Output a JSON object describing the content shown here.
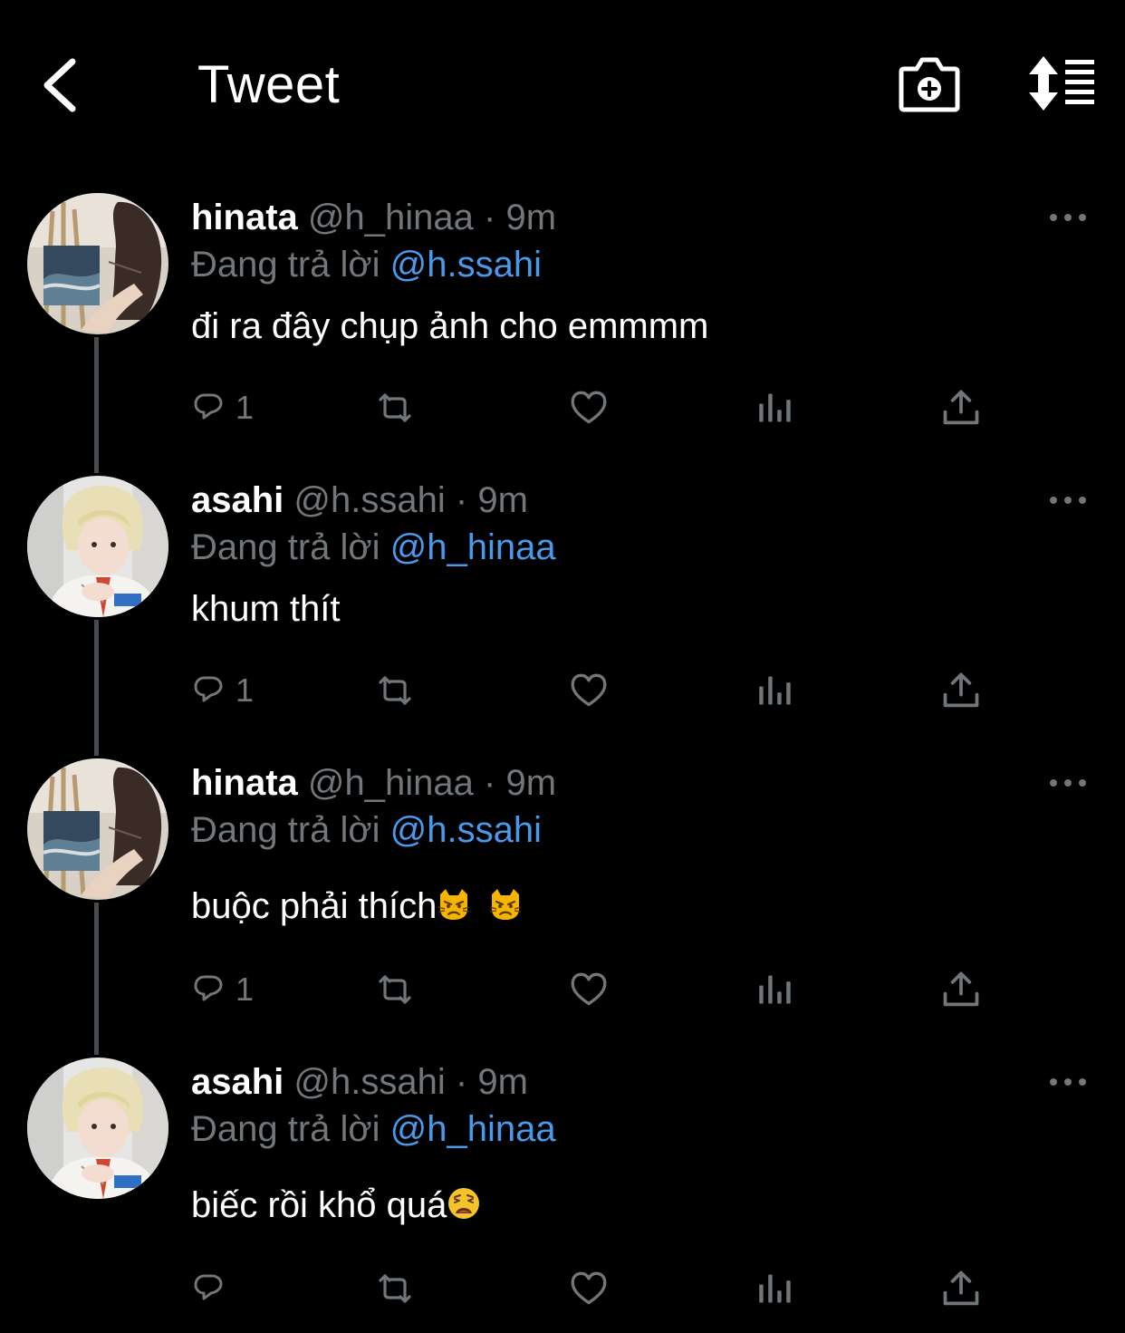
{
  "header": {
    "back_icon": "chevron-left-icon",
    "title": "Tweet",
    "camera_icon": "camera-add-icon",
    "sort_icon": "sort-list-icon"
  },
  "colors": {
    "background": "#000000",
    "text_primary": "#ffffff",
    "text_secondary": "#71767b",
    "mention": "#4a99e9",
    "thread_line": "#444b52"
  },
  "tweets": [
    {
      "name": "hinata",
      "handle": "@h_hinaa",
      "dot": "·",
      "time": "9m",
      "reply_prefix": "Đang trả lời",
      "reply_to": "@h.ssahi",
      "text": "đi ra đây chụp ảnh cho emmmm",
      "reply_count": "1",
      "avatar": "painting-girl-avatar"
    },
    {
      "name": "asahi",
      "handle": "@h.ssahi",
      "dot": "·",
      "time": "9m",
      "reply_prefix": "Đang trả lời",
      "reply_to": "@h_hinaa",
      "text": "khum thít",
      "reply_count": "1",
      "avatar": "blond-boy-avatar"
    },
    {
      "name": "hinata",
      "handle": "@h_hinaa",
      "dot": "·",
      "time": "9m",
      "reply_prefix": "Đang trả lời",
      "reply_to": "@h.ssahi",
      "text": "buộc phải thích",
      "emojis": [
        "pouting-cat-emoji",
        "pouting-cat-emoji"
      ],
      "reply_count": "1",
      "avatar": "painting-girl-avatar"
    },
    {
      "name": "asahi",
      "handle": "@h.ssahi",
      "dot": "·",
      "time": "9m",
      "reply_prefix": "Đang trả lời",
      "reply_to": "@h_hinaa",
      "text": "biếc rồi khổ quá",
      "emojis": [
        "weary-face-emoji"
      ],
      "reply_count": "",
      "avatar": "blond-boy-avatar"
    }
  ],
  "action_icons": [
    "reply-icon",
    "retweet-icon",
    "like-icon",
    "analytics-icon",
    "share-icon"
  ]
}
